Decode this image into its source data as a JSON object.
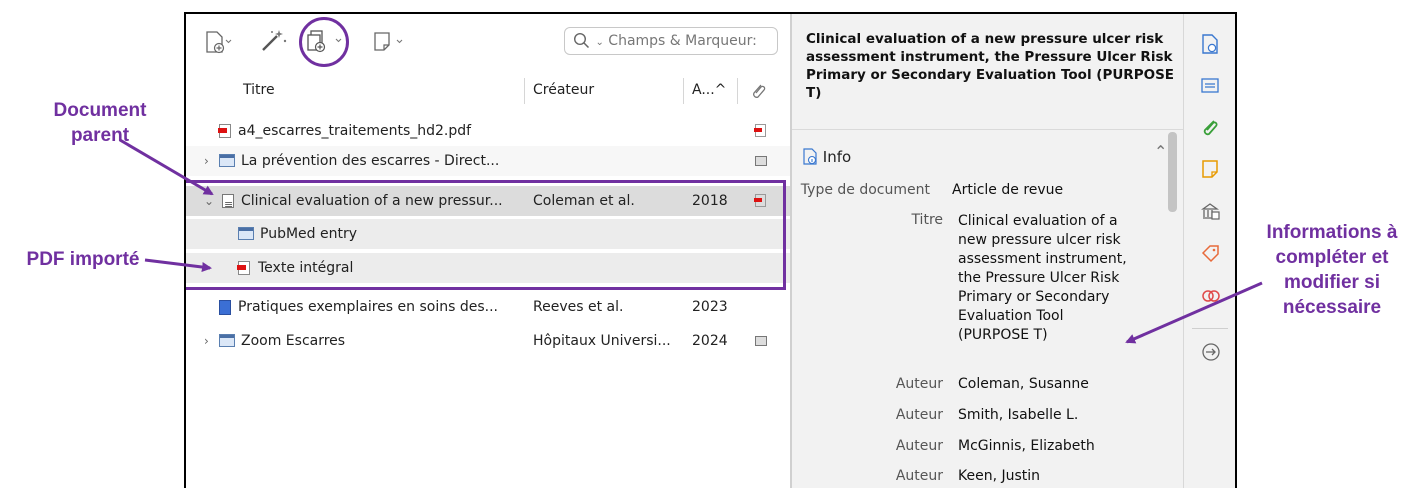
{
  "toolbar": {
    "search_placeholder": "Champs & Marqueur:"
  },
  "columns": {
    "title": "Titre",
    "creator": "Créateur",
    "year": "A...^"
  },
  "items": [
    {
      "title": "a4_escarres_traitements_hd2.pdf",
      "creator": "",
      "year": "",
      "icon": "pdf-file-icon",
      "attachment": "pdf"
    },
    {
      "title": "La prévention des escarres - Direct...",
      "creator": "",
      "year": "",
      "icon": "web-page-icon",
      "attachment": "web"
    },
    {
      "title": "Clinical evaluation of a new pressur...",
      "creator": "Coleman et al.",
      "year": "2018",
      "icon": "journal-article-icon",
      "attachment": "pdf"
    },
    {
      "title": "PubMed entry",
      "creator": "",
      "year": "",
      "icon": "web-snapshot-icon",
      "attachment": ""
    },
    {
      "title": "Texte intégral",
      "creator": "",
      "year": "",
      "icon": "pdf-file-icon",
      "attachment": ""
    },
    {
      "title": "Pratiques exemplaires en soins des...",
      "creator": "Reeves et al.",
      "year": "2023",
      "icon": "book-icon",
      "attachment": ""
    },
    {
      "title": "Zoom Escarres",
      "creator": "Hôpitaux Universi...",
      "year": "2024",
      "icon": "web-page-icon",
      "attachment": "web"
    }
  ],
  "detail": {
    "header_title": "Clinical evaluation of a new pressure ulcer risk assessment instrument, the Pressure Ulcer Risk Primary or Secondary Evaluation Tool (PURPOSE T)",
    "section": "Info",
    "doc_type_label": "Type de document",
    "doc_type_value": "Article de revue",
    "title_label": "Titre",
    "title_lines": [
      "Clinical evaluation of a",
      "new pressure ulcer risk",
      "assessment instrument,",
      "the Pressure Ulcer Risk",
      "Primary or Secondary",
      "Evaluation Tool",
      "(PURPOSE T)"
    ],
    "author_label": "Auteur",
    "authors": [
      "Coleman, Susanne",
      "Smith, Isabelle L.",
      "McGinnis, Elizabeth",
      "Keen, Justin"
    ]
  },
  "annotations": {
    "parent": "Document\nparent",
    "pdf": "PDF importé",
    "info": "Informations à\ncompléter et\nmodifier si\nnécessaire"
  },
  "colors": {
    "annotation": "#7030a0",
    "selected_row": "#dcdcdc",
    "child_row": "#ececec"
  }
}
